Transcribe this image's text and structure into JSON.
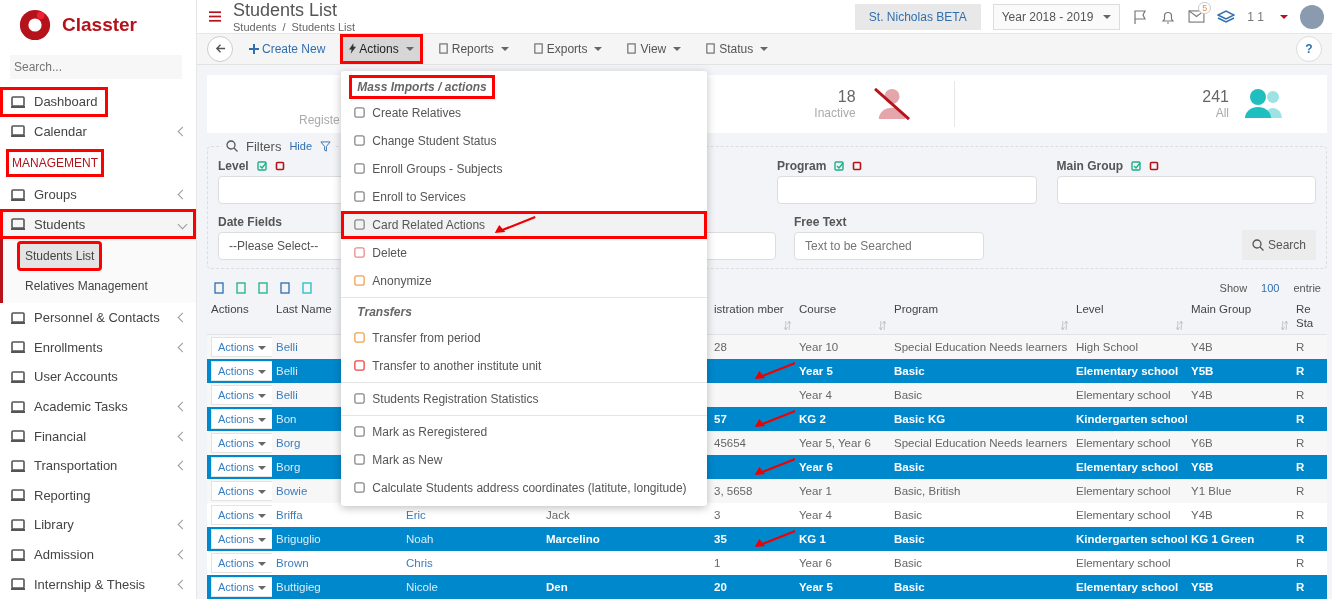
{
  "sidebar": {
    "brand": "Classter",
    "search": {
      "placeholder": "Search..."
    },
    "items": [
      {
        "kind": "link",
        "label": "Dashboard",
        "annotated": true
      },
      {
        "kind": "link",
        "label": "Calendar",
        "has_children": true,
        "expanded": false
      },
      {
        "kind": "section",
        "label": "MANAGEMENT",
        "annotated": true
      },
      {
        "kind": "link",
        "label": "Groups",
        "has_children": true,
        "expanded": false
      },
      {
        "kind": "link",
        "label": "Students",
        "has_children": true,
        "expanded": true,
        "annotated": true,
        "children": [
          {
            "label": "Students List",
            "selected": true,
            "annotated": true
          },
          {
            "label": "Relatives Management",
            "selected": false
          }
        ]
      },
      {
        "kind": "link",
        "label": "Personnel & Contacts",
        "has_children": true,
        "expanded": false
      },
      {
        "kind": "link",
        "label": "Enrollments",
        "has_children": true,
        "expanded": false
      },
      {
        "kind": "link",
        "label": "User Accounts"
      },
      {
        "kind": "link",
        "label": "Academic Tasks",
        "has_children": true,
        "expanded": false
      },
      {
        "kind": "link",
        "label": "Financial",
        "has_children": true,
        "expanded": false
      },
      {
        "kind": "link",
        "label": "Transportation",
        "has_children": true,
        "expanded": false
      },
      {
        "kind": "link",
        "label": "Reporting"
      },
      {
        "kind": "link",
        "label": "Library",
        "has_children": true,
        "expanded": false
      },
      {
        "kind": "link",
        "label": "Admission",
        "has_children": true,
        "expanded": false
      },
      {
        "kind": "link",
        "label": "Internship & Thesis",
        "has_children": true,
        "expanded": false
      }
    ]
  },
  "header": {
    "title": "Students List",
    "breadcrumb": [
      "Students",
      "Students List"
    ],
    "separator": "/",
    "school": "St. Nicholas BETA",
    "year": "Year 2018 - 2019",
    "mail_badge": "5",
    "user": "1 1"
  },
  "toolbar": {
    "buttons": [
      {
        "kind": "create",
        "label": "Create New"
      },
      {
        "kind": "actions",
        "label": "Actions",
        "open": true,
        "annotated": true
      },
      {
        "kind": "reports",
        "label": "Reports"
      },
      {
        "kind": "exports",
        "label": "Exports"
      },
      {
        "kind": "view",
        "label": "View"
      },
      {
        "kind": "status",
        "label": "Status"
      }
    ],
    "help": "?",
    "menu": [
      {
        "kind": "header",
        "label": "Mass Imports / actions",
        "annotated": true
      },
      {
        "kind": "item",
        "label": "Create Relatives",
        "hovered": false
      },
      {
        "kind": "item",
        "label": "Change Student Status",
        "hovered": false
      },
      {
        "kind": "item",
        "label": "Enroll Groups - Subjects",
        "hovered": false
      },
      {
        "kind": "item",
        "label": "Enroll to Services",
        "hovered": false
      },
      {
        "kind": "item",
        "label": "Card Related Actions",
        "hovered": true,
        "annotated": true,
        "arrow": true
      },
      {
        "kind": "item",
        "label": "Delete",
        "hovered": false
      },
      {
        "kind": "item",
        "label": "Anonymize",
        "hovered": false
      },
      {
        "kind": "divider"
      },
      {
        "kind": "header",
        "label": "Transfers"
      },
      {
        "kind": "item",
        "label": "Transfer from period",
        "hovered": false
      },
      {
        "kind": "item",
        "label": "Transfer to another institute unit",
        "hovered": false
      },
      {
        "kind": "divider"
      },
      {
        "kind": "item",
        "label": "Students Registration Statistics",
        "hovered": false
      },
      {
        "kind": "divider"
      },
      {
        "kind": "item",
        "label": "Mark as Reregistered",
        "hovered": false
      },
      {
        "kind": "item",
        "label": "Mark as New",
        "hovered": false
      },
      {
        "kind": "item",
        "label": "Calculate Students address coordinates (latitute, longitude)",
        "hovered": false
      }
    ]
  },
  "stats": [
    {
      "kind": "registered",
      "label": "Registe"
    },
    {
      "kind": "inactive",
      "value": "18",
      "label": "Inactive"
    },
    {
      "kind": "all",
      "value": "241",
      "label": "All"
    }
  ],
  "filters": {
    "title": "Filters",
    "hide": "Hide",
    "row1": [
      {
        "label": "Level"
      },
      {
        "label": "Program"
      },
      {
        "label": "Main Group"
      }
    ],
    "date_fields": {
      "label": "Date Fields",
      "value": "--Please Select--"
    },
    "free_text": {
      "label": "Free Text",
      "placeholder": "Text to be Searched"
    },
    "search": "Search"
  },
  "table": {
    "show": "Show",
    "page_size": "100",
    "entries": "entrie",
    "columns": [
      {
        "label": "Actions"
      },
      {
        "label": "Last Name"
      },
      {},
      {},
      {
        "label": "istration mber"
      },
      {
        "label": "Course"
      },
      {
        "label": "Program"
      },
      {
        "label": "Level"
      },
      {
        "label": "Main Group"
      },
      {
        "label": "Re Sta"
      }
    ],
    "rows": [
      {
        "selected": false,
        "cells": [
          "Actions",
          "Belli",
          null,
          null,
          "28",
          "Year 10",
          "Special Education Needs learners",
          "High School",
          "Y4B",
          "R"
        ]
      },
      {
        "selected": true,
        "arrow": true,
        "cells": [
          "Actions",
          "Belli",
          null,
          null,
          null,
          "Year 5",
          "Basic",
          "Elementary school",
          "Y5B",
          "R"
        ]
      },
      {
        "selected": false,
        "cells": [
          "Actions",
          "Belli",
          null,
          null,
          null,
          "Year 4",
          "Basic",
          "Elementary school",
          "Y4B",
          "R"
        ]
      },
      {
        "selected": true,
        "arrow": true,
        "cells": [
          "Actions",
          "Bon",
          null,
          null,
          "57",
          "KG 2",
          "Basic KG",
          "Kindergarten school",
          null,
          "R"
        ]
      },
      {
        "selected": false,
        "cells": [
          "Actions",
          "Borg",
          null,
          null,
          "45654",
          "Year 5, Year 6",
          "Special Education Needs learners",
          "Elementary school",
          "Y6B",
          "R"
        ]
      },
      {
        "selected": true,
        "arrow": true,
        "cells": [
          "Actions",
          "Borg",
          null,
          null,
          null,
          "Year 6",
          "Basic",
          "Elementary school",
          "Y6B",
          "R"
        ]
      },
      {
        "selected": false,
        "cells": [
          "Actions",
          "Bowie",
          null,
          null,
          "3, 5658",
          "Year 1",
          "Basic, British",
          "Elementary school",
          "Y1 Blue",
          "R"
        ]
      },
      {
        "selected": false,
        "cells": [
          "Actions",
          "Briffa",
          "Eric",
          "Jack",
          "3",
          "Year 4",
          "Basic",
          "Elementary school",
          "Y4B",
          "R"
        ]
      },
      {
        "selected": true,
        "arrow": true,
        "cells": [
          "Actions",
          "Briguglio",
          "Noah",
          "Marcelino",
          "35",
          "KG 1",
          "Basic",
          "Kindergarten school",
          "KG 1 Green",
          "R"
        ]
      },
      {
        "selected": false,
        "cells": [
          "Actions",
          "Brown",
          "Chris",
          null,
          "1",
          "Year 6",
          "Basic",
          "Elementary school",
          null,
          "R"
        ]
      },
      {
        "selected": true,
        "cells": [
          "Actions",
          "Buttigieg",
          "Nicole",
          "Den",
          "20",
          "Year 5",
          "Basic",
          "Elementary school",
          "Y5B",
          "R"
        ]
      }
    ]
  }
}
